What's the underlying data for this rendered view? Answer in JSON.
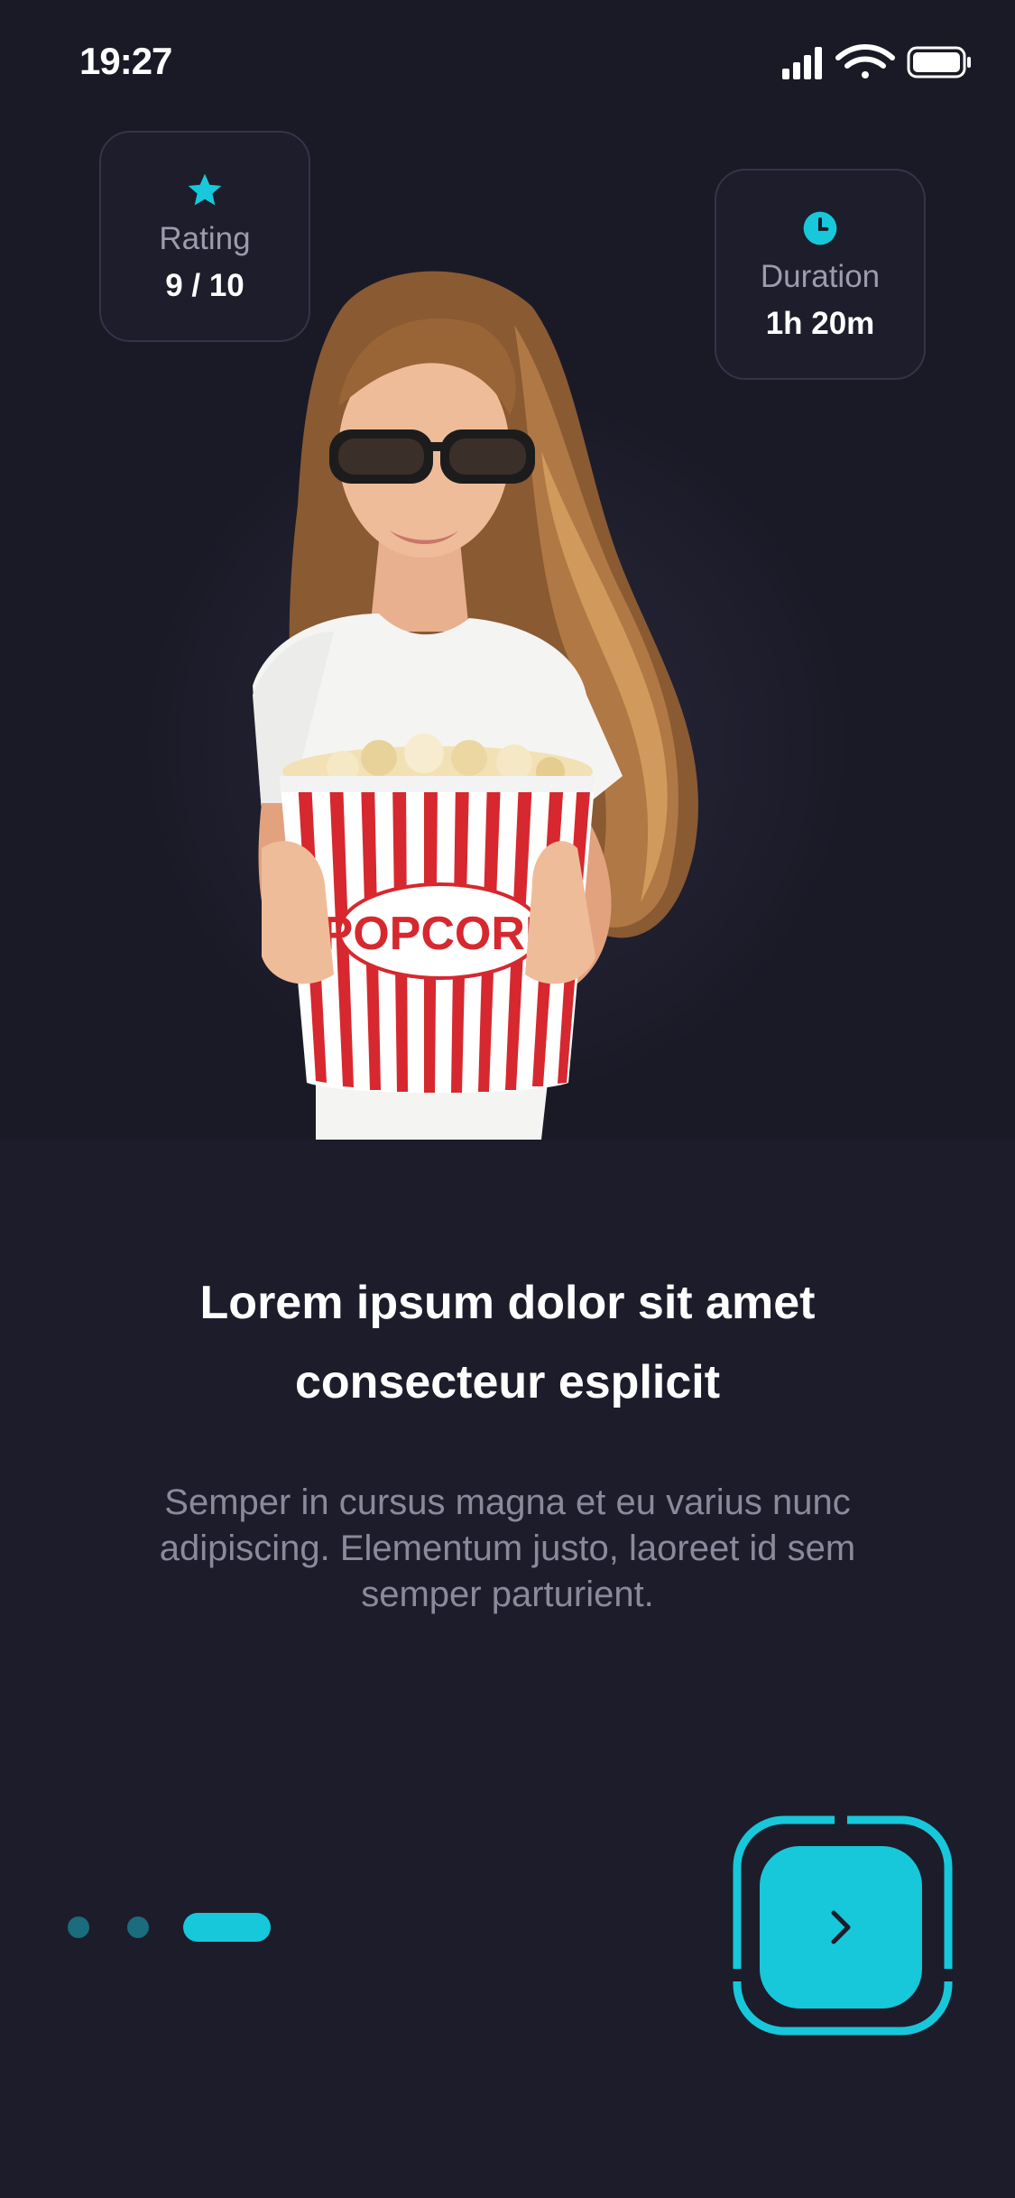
{
  "status_bar": {
    "time": "19:27",
    "battery_icon": "battery-full-icon",
    "wifi_icon": "wifi-icon",
    "signal_icon": "cellular-signal-icon"
  },
  "stats": {
    "rating": {
      "label": "Rating",
      "value": "9 / 10",
      "icon": "star-icon"
    },
    "duration": {
      "label": "Duration",
      "value": "1h 20m",
      "icon": "clock-icon"
    }
  },
  "hero": {
    "cup_text": "POPCORN"
  },
  "content": {
    "title": "Lorem ipsum dolor sit amet\nconsecteur esplicit",
    "description": "Semper in cursus magna et eu varius nunc adipiscing. Elementum justo, laoreet id sem semper parturient."
  },
  "pager": {
    "total": 3,
    "active_index": 2
  },
  "next_button": {
    "icon": "chevron-right-icon",
    "progress": 1.0
  },
  "colors": {
    "accent": "#16c8da",
    "background": "#1d1c2b",
    "hero_background": "#1a1a27",
    "muted_text": "#8b8a9c",
    "inactive_dot": "#1b6c7c"
  }
}
